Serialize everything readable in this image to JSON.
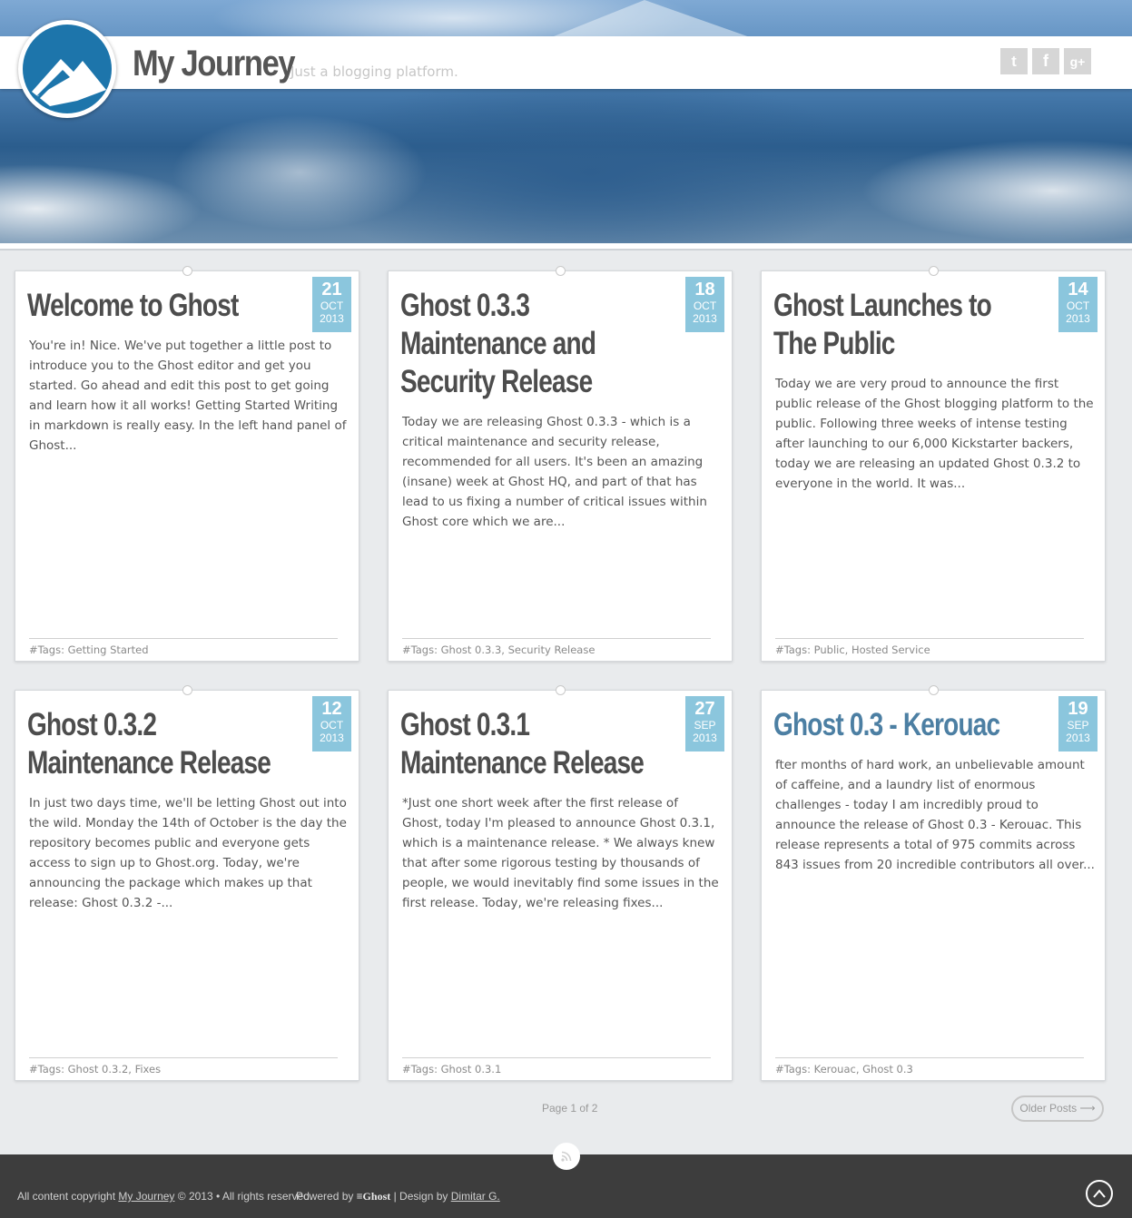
{
  "header": {
    "title": "My Journey",
    "description": "Just a blogging platform.",
    "social": [
      {
        "icon": "twitter-icon",
        "glyph": "t"
      },
      {
        "icon": "facebook-icon",
        "glyph": "f"
      },
      {
        "icon": "google-plus-icon",
        "glyph": "g+"
      }
    ]
  },
  "posts": [
    {
      "title": "Welcome to Ghost",
      "day": "21",
      "month": "OCT",
      "year": "2013",
      "excerpt": "You're in! Nice. We've put together a little post to introduce you to the Ghost editor and get you started. Go ahead and edit this post to get going and learn how it all works! Getting Started Writing in markdown is really easy. In the left hand panel of Ghost...",
      "tags": "#Tags: Getting Started"
    },
    {
      "title": "Ghost 0.3.3 Maintenance and Security Release",
      "day": "18",
      "month": "OCT",
      "year": "2013",
      "excerpt": "Today we are releasing Ghost 0.3.3 - which is a critical maintenance and security release, recommended for all users. It's been an amazing (insane) week at Ghost HQ, and part of that has lead to us fixing a number of critical issues within Ghost core which we are...",
      "tags": "#Tags: Ghost 0.3.3, Security Release"
    },
    {
      "title": "Ghost Launches to The Public",
      "day": "14",
      "month": "OCT",
      "year": "2013",
      "excerpt": "Today we are very proud to announce the first public release of the Ghost blogging platform to the public. Following three weeks of intense testing after launching to our 6,000 Kickstarter backers, today we are releasing an updated Ghost 0.3.2 to everyone in the world. It was...",
      "tags": "#Tags: Public, Hosted Service"
    },
    {
      "title": "Ghost 0.3.2 Maintenance Release",
      "day": "12",
      "month": "OCT",
      "year": "2013",
      "excerpt": "In just two days time, we'll be letting Ghost out into the wild. Monday the 14th of October is the day the repository becomes public and everyone gets access to sign up to Ghost.org. Today, we're announcing the package which makes up that release: Ghost 0.3.2 -...",
      "tags": "#Tags: Ghost 0.3.2, Fixes"
    },
    {
      "title": "Ghost 0.3.1 Maintenance Release",
      "day": "27",
      "month": "SEP",
      "year": "2013",
      "excerpt": "*Just one short week after the first release of Ghost, today I'm pleased to announce Ghost 0.3.1, which is a maintenance release. * We always knew that after some rigorous testing by thousands of people, we would inevitably find some issues in the first release. Today, we're releasing fixes...",
      "tags": "#Tags: Ghost 0.3.1"
    },
    {
      "title": "Ghost 0.3 - Kerouac",
      "day": "19",
      "month": "SEP",
      "year": "2013",
      "excerpt": "fter months of hard work, an unbelievable amount of caffeine, and a laundry list of enormous challenges - today I am incredibly proud to announce the release of Ghost 0.3 - Kerouac. This release represents a total of 975 commits across 843 issues from 20 incredible contributors all over...",
      "tags": "#Tags: Kerouac, Ghost 0.3"
    }
  ],
  "pagination": {
    "page_label": "Page 1 of 2",
    "older_label": "Older Posts ⟶"
  },
  "footer": {
    "copyright_prefix": "All content copyright",
    "site_link": "My Journey",
    "copyright_suffix": "© 2013 • All rights reserved.",
    "powered_prefix": "Powered by",
    "ghost_label": "≡Ghost",
    "design_prefix": "| Design by",
    "designer": "Dimitar G."
  },
  "colors": {
    "accent": "#1d75ab",
    "date_badge": "#8bc6dd",
    "footer_bg": "#3d3d3d",
    "link_title": "#4c7fa3"
  }
}
